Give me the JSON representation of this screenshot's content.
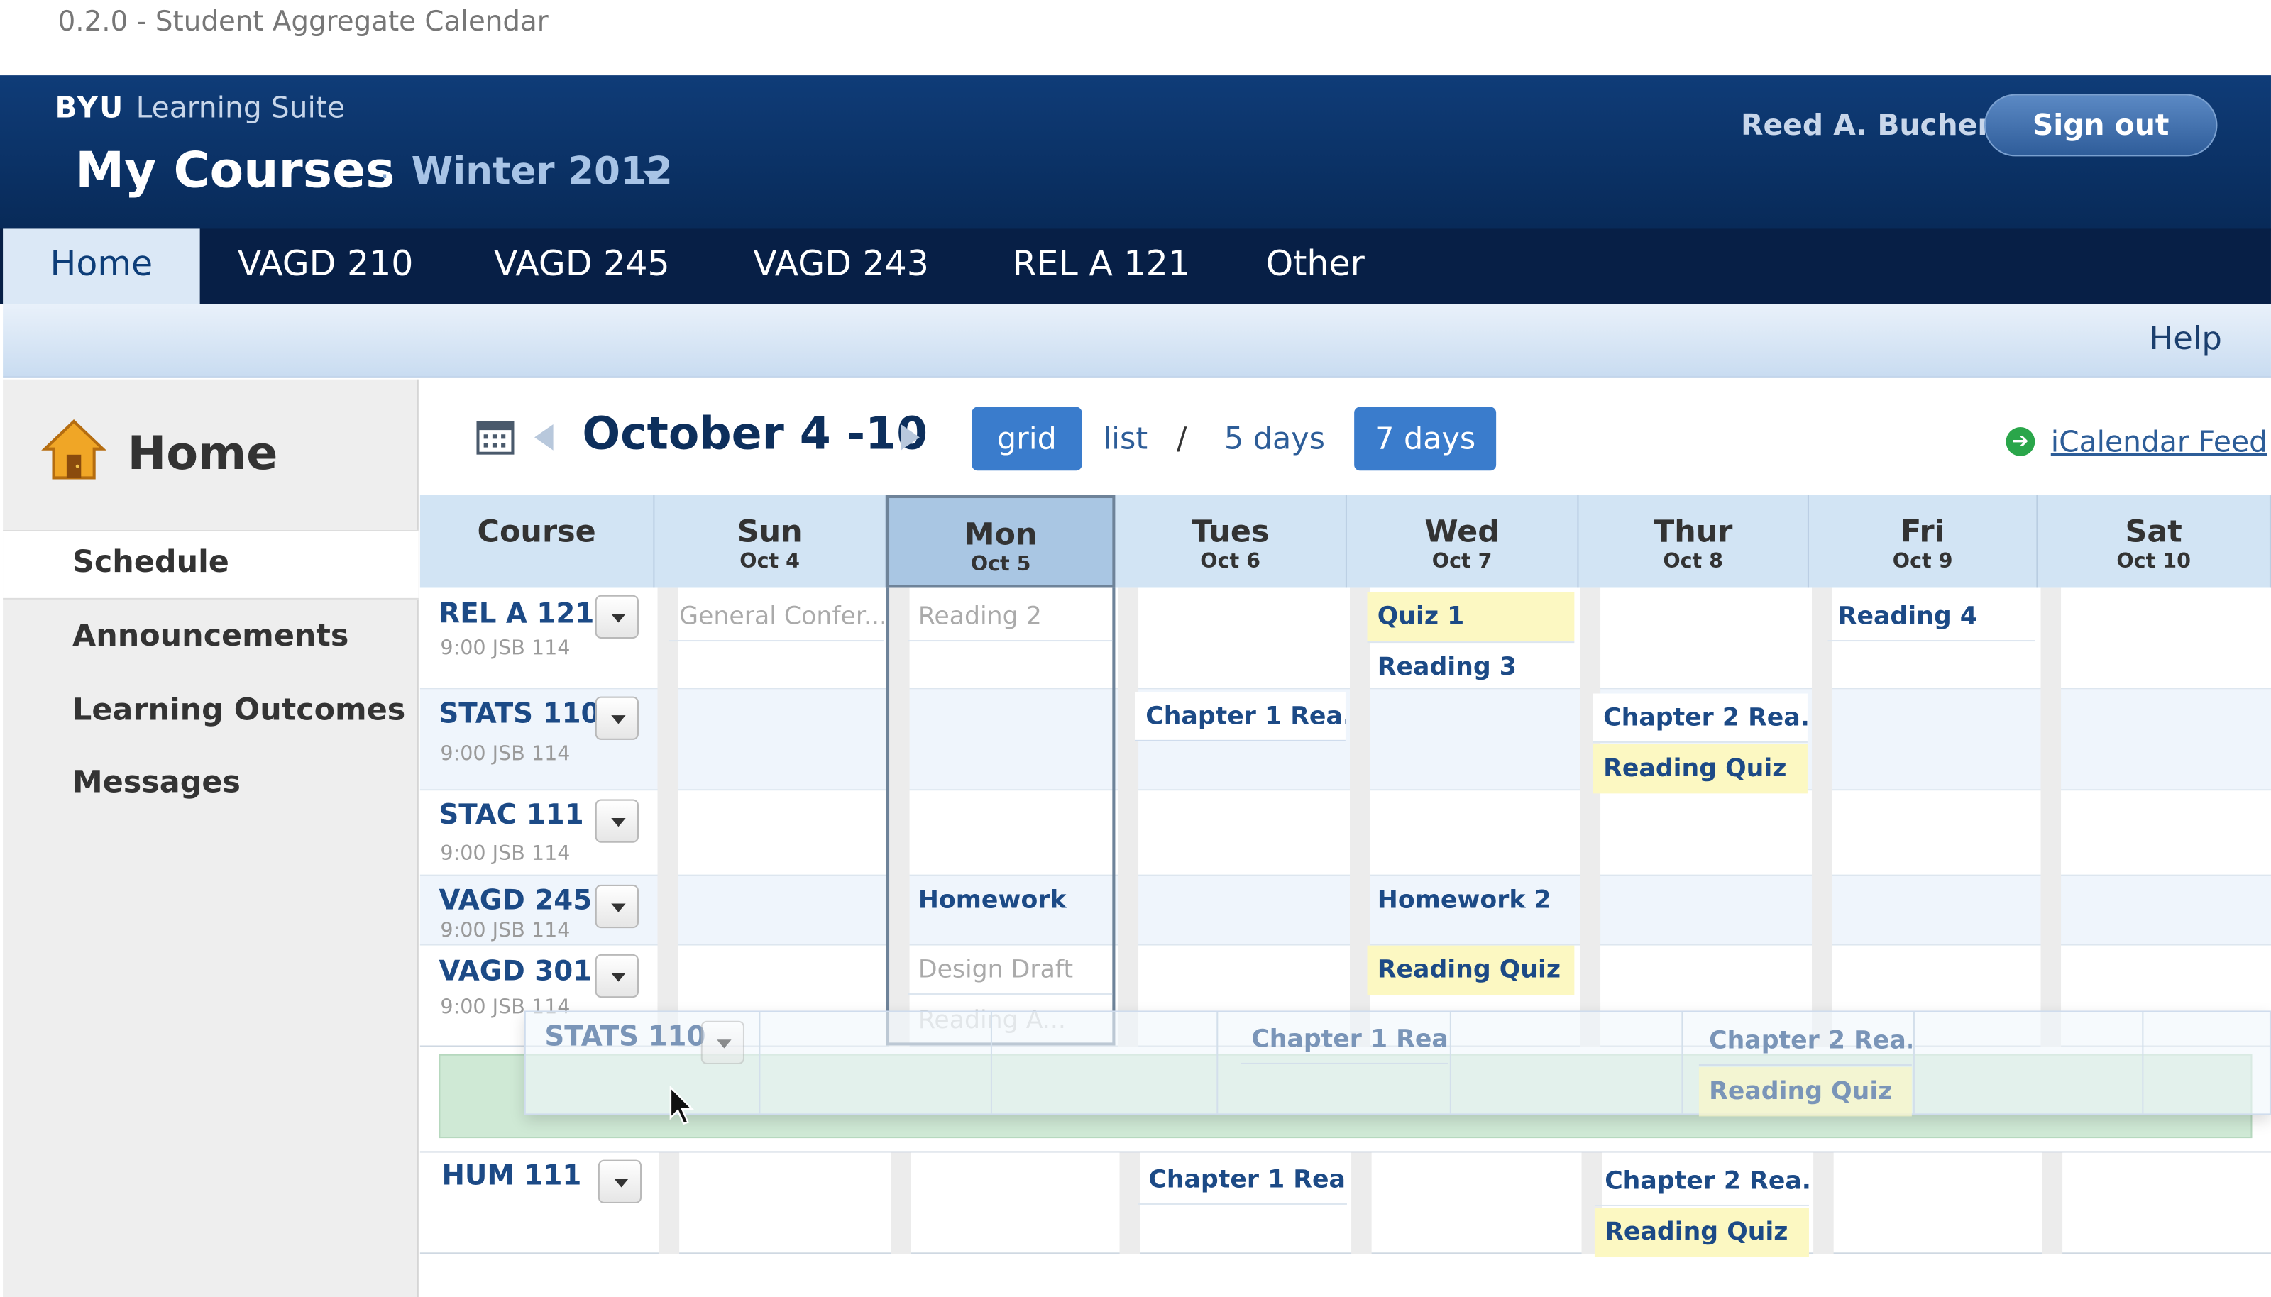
{
  "version_label": "0.2.0 - Student Aggregate Calendar",
  "brand": {
    "name": "BYU",
    "product": "Learning Suite"
  },
  "header": {
    "title": "My Courses",
    "separator": "·",
    "term": "Winter 2012",
    "user": "Reed A. Bucher",
    "sign_out": "Sign out"
  },
  "tabs": [
    "Home",
    "VAGD 210",
    "VAGD 245",
    "VAGD 243",
    "REL A 121",
    "Other"
  ],
  "help": "Help",
  "sidebar": {
    "title": "Home",
    "items": [
      "Schedule",
      "Announcements",
      "Learning Outcomes",
      "Messages"
    ]
  },
  "toolbar": {
    "range": "October 4 -10",
    "views": [
      "grid",
      "list",
      "/",
      "5 days",
      "7 days"
    ],
    "feed": "iCalendar Feed"
  },
  "columns": {
    "course": "Course",
    "days": [
      {
        "d": "Sun",
        "date": "Oct 4"
      },
      {
        "d": "Mon",
        "date": "Oct 5"
      },
      {
        "d": "Tues",
        "date": "Oct 6"
      },
      {
        "d": "Wed",
        "date": "Oct 7"
      },
      {
        "d": "Thur",
        "date": "Oct 8"
      },
      {
        "d": "Fri",
        "date": "Oct 9"
      },
      {
        "d": "Sat",
        "date": "Oct 10"
      }
    ]
  },
  "courses": [
    {
      "name": "REL A 121",
      "time": "9:00 JSB 114"
    },
    {
      "name": "STATS 110",
      "time": "9:00 JSB 114"
    },
    {
      "name": "STAC 111",
      "time": "9:00 JSB 114"
    },
    {
      "name": "VAGD 245",
      "time": "9:00 JSB 114"
    },
    {
      "name": "VAGD 301",
      "time": "9:00 JSB 114"
    },
    {
      "name": "HUM 111",
      "time": ""
    }
  ],
  "events": {
    "rel_sun": "General Confer...",
    "rel_mon": "Reading 2",
    "rel_wed1": "Quiz 1",
    "rel_wed2": "Reading 3",
    "rel_fri": "Reading 4",
    "stats_tue": "Chapter 1 Rea...",
    "stats_thu1": "Chapter 2 Rea...",
    "stats_thu2": "Reading Quiz",
    "vagd245_mon": "Homework",
    "vagd245_wed": "Homework 2",
    "vagd301_mon": "Design Draft",
    "vagd301_mon2": "Reading A...",
    "vagd301_wed": "Reading Quiz",
    "hum_tue": "Chapter 1 Rea...",
    "hum_thu1": "Chapter 2 Rea...",
    "hum_thu2": "Reading Quiz"
  },
  "drag_ghost": {
    "course": "STATS 110",
    "e1": "Chapter 1 Rea...",
    "e2": "Chapter 2 Rea...",
    "e3": "Reading Quiz"
  }
}
